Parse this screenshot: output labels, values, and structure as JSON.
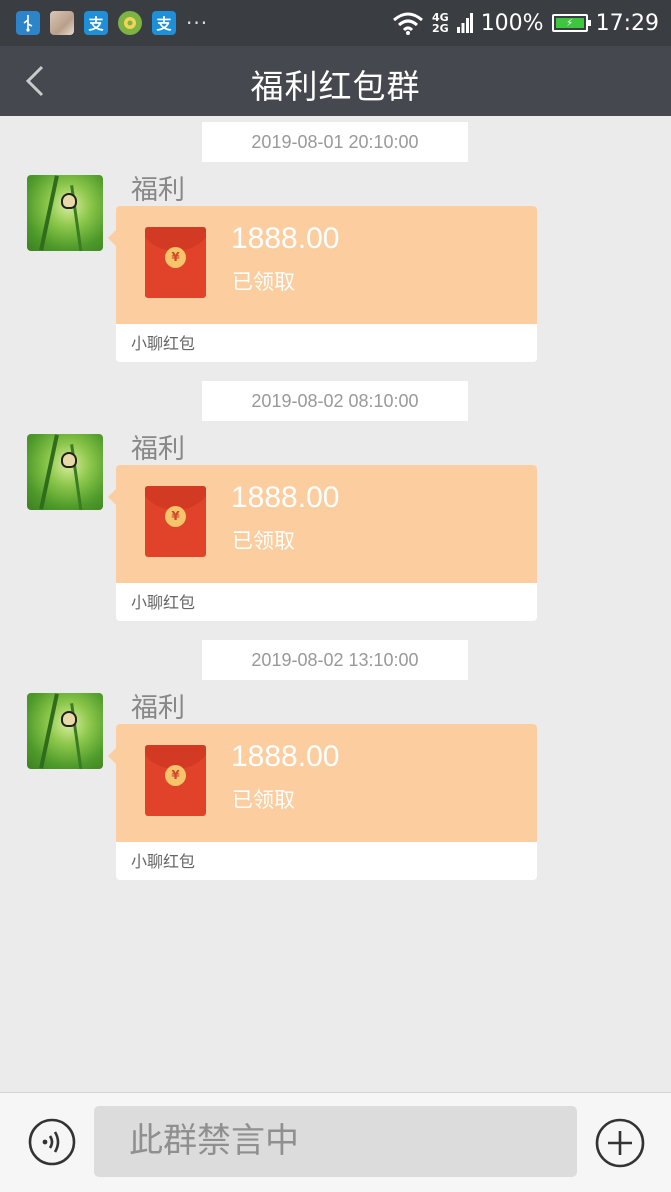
{
  "status_bar": {
    "more": "···",
    "pay_glyph": "支",
    "net_top": "4G",
    "net_bottom": "2G",
    "battery": "100%",
    "time": "17:29",
    "icons": [
      "usb-icon",
      "gallery-icon",
      "alipay-icon",
      "taobao-icon",
      "alipay-icon",
      "wifi-icon",
      "signal-icon",
      "battery-charging-icon"
    ]
  },
  "nav": {
    "title": "福利红包群",
    "back_icon": "chevron-left-icon"
  },
  "messages": [
    {
      "timestamp": "2019-08-01 20:10:00",
      "sender": "福利",
      "amount": "1888.00",
      "status": "已领取",
      "label": "小聊红包",
      "coin": "¥"
    },
    {
      "timestamp": "2019-08-02 08:10:00",
      "sender": "福利",
      "amount": "1888.00",
      "status": "已领取",
      "label": "小聊红包",
      "coin": "¥"
    },
    {
      "timestamp": "2019-08-02 13:10:00",
      "sender": "福利",
      "amount": "1888.00",
      "status": "已领取",
      "label": "小聊红包",
      "coin": "¥"
    }
  ],
  "input": {
    "placeholder": "此群禁言中",
    "voice_icon": "voice-icon",
    "plus_icon": "plus-circle-icon"
  },
  "colors": {
    "status_bar": "#3a3d42",
    "nav_bar": "#45484e",
    "background": "#ebebeb",
    "packet": "#fbcd9f",
    "envelope": "#e0432a"
  }
}
